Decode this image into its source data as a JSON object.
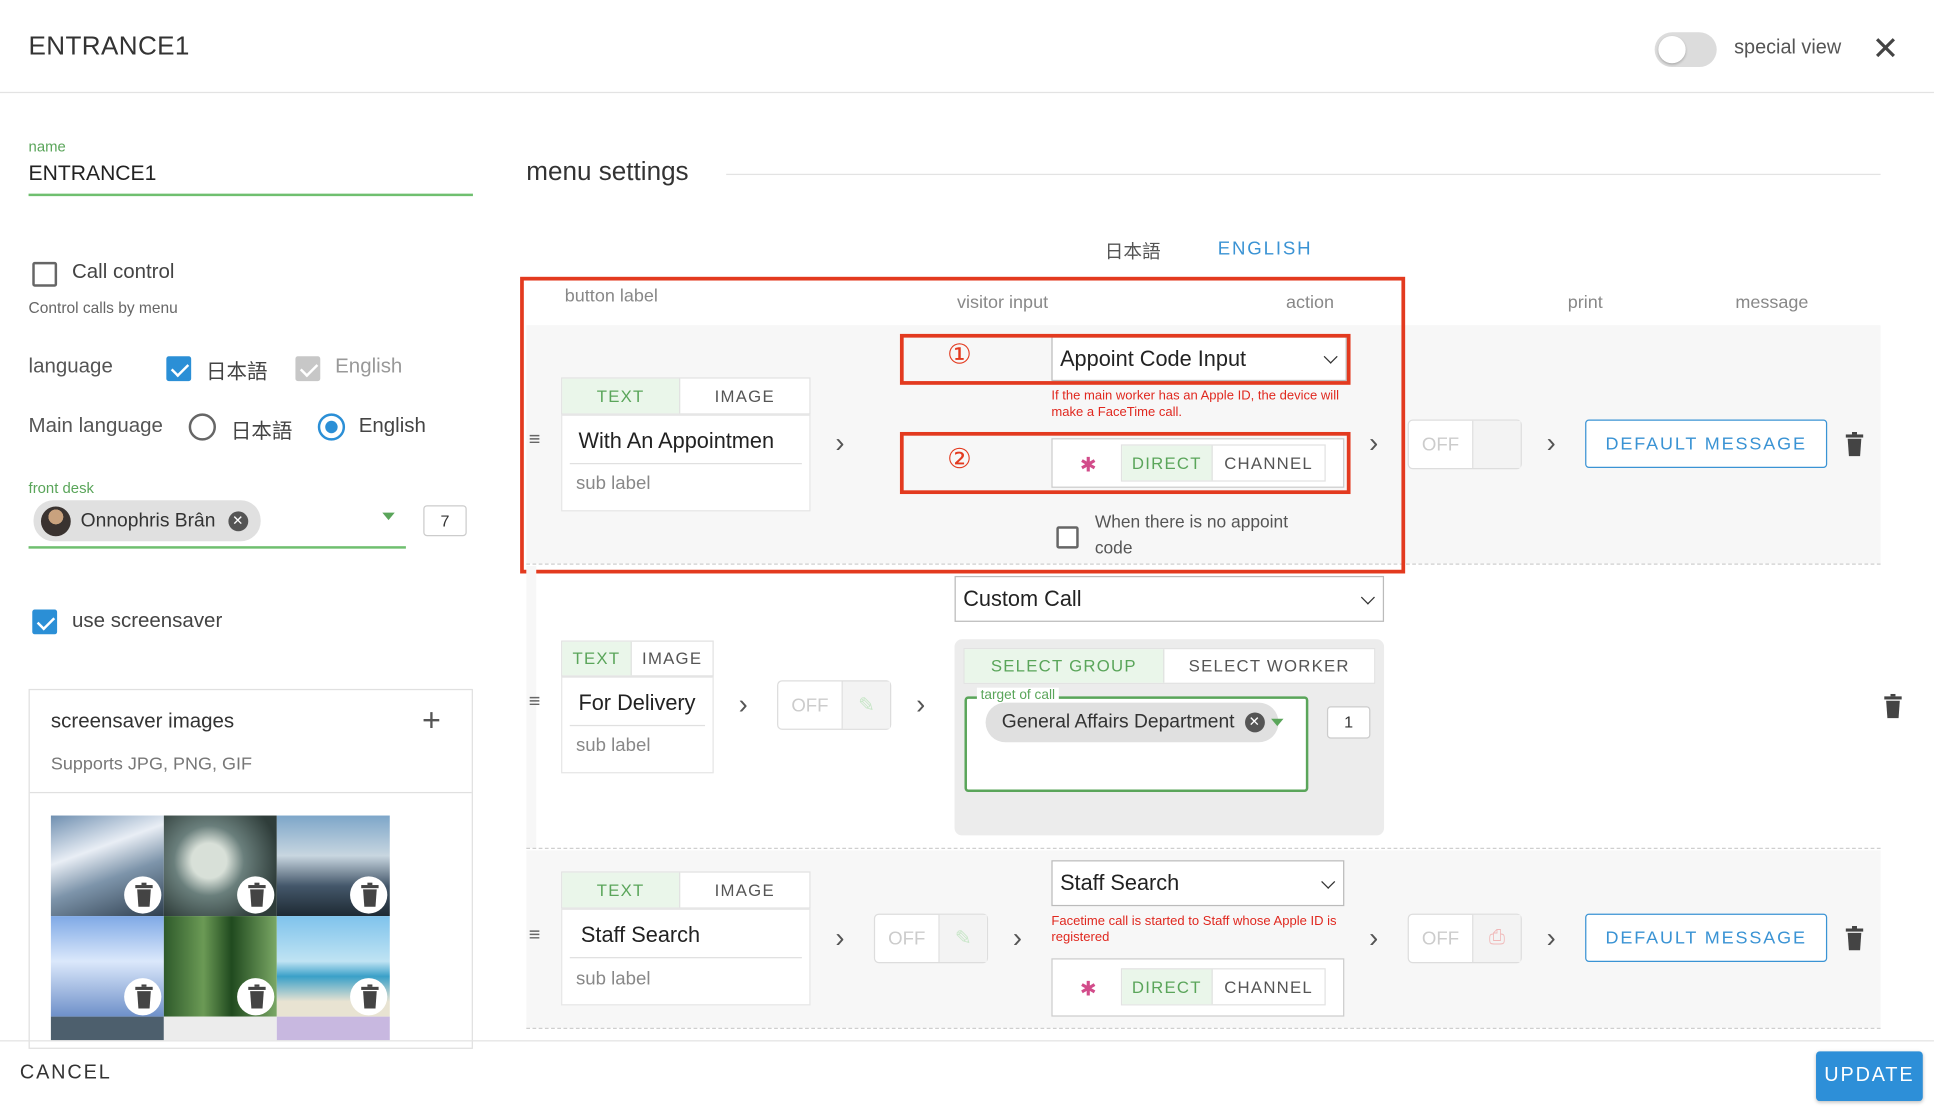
{
  "header": {
    "title": "ENTRANCE1",
    "special_view_label": "special view",
    "special_view_on": false,
    "close_icon": "close-icon"
  },
  "left": {
    "name_label": "name",
    "name_value": "ENTRANCE1",
    "call_control_label": "Call control",
    "call_control_checked": false,
    "call_control_help": "Control calls by menu",
    "language_label": "language",
    "lang_ja": "日本語",
    "lang_ja_checked": true,
    "lang_en": "English",
    "lang_en_checked": true,
    "main_language_label": "Main language",
    "main_lang_ja": "日本語",
    "main_lang_en": "English",
    "main_language_selected": "English",
    "front_desk_label": "front desk",
    "front_desk_person": "Onnophris Brân",
    "front_desk_count": "7",
    "use_screensaver_label": "use screensaver",
    "use_screensaver_checked": true,
    "screensaver_title": "screensaver images",
    "screensaver_formats": "Supports JPG, PNG, GIF"
  },
  "menu": {
    "section_title": "menu settings",
    "lang_tabs": [
      "日本語",
      "ENGLISH"
    ],
    "active_lang_tab": "ENGLISH",
    "col_button_label": "button label",
    "col_visitor_input": "visitor input",
    "col_action": "action",
    "col_print": "print",
    "col_message": "message",
    "tab_text": "TEXT",
    "tab_image": "IMAGE",
    "sub_label_placeholder": "sub label",
    "off_label": "OFF",
    "direct_label": "DIRECT",
    "channel_label": "CHANNEL",
    "default_message": "DEFAULT MESSAGE",
    "rows": [
      {
        "label": "With An Appointmen",
        "action_select": "Appoint Code Input",
        "note": "If the main worker has an Apple ID, the device will make a FaceTime call.",
        "no_code_label": "When there is no appoint code",
        "marker1": "①",
        "marker2": "②"
      },
      {
        "label": "For Delivery",
        "action_select": "Custom Call",
        "select_group": "SELECT GROUP",
        "select_worker": "SELECT WORKER",
        "target_label": "target of call",
        "target_value": "General Affairs Department",
        "target_count": "1"
      },
      {
        "label": "Staff Search",
        "action_select": "Staff Search",
        "note": "Facetime call is started to Staff whose Apple ID is registered"
      }
    ]
  },
  "footer": {
    "cancel": "CANCEL",
    "update": "UPDATE"
  },
  "colors": {
    "accent_blue": "#2b8fd6",
    "accent_green": "#5aa55a",
    "highlight_red": "#e33a1f",
    "note_red": "#e0281f"
  }
}
